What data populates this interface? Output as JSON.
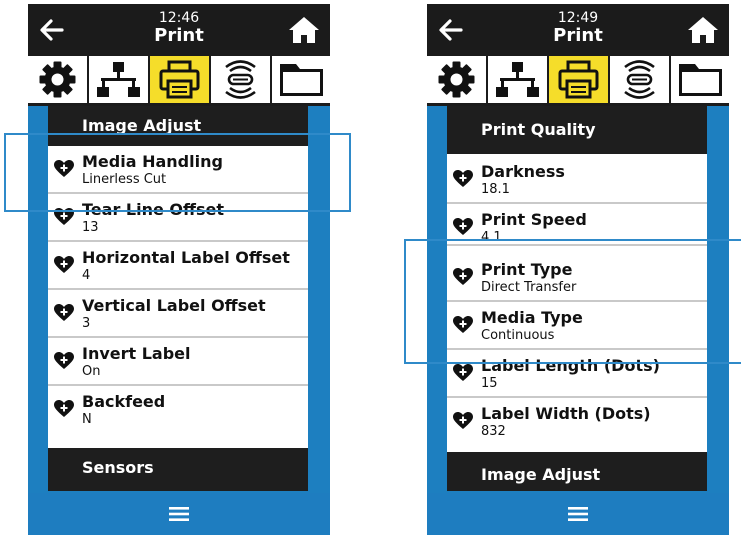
{
  "colors": {
    "accent_blue": "#1d7fc0",
    "selected_tab": "#f5dd2a",
    "bar_dark": "#1b1b1b",
    "callout": "#2f8ac9"
  },
  "icons": [
    "back-arrow-icon",
    "home-icon",
    "settings-gear-icon",
    "network-icon",
    "printer-icon",
    "wireless-icon",
    "folder-icon",
    "heart-plus-icon",
    "hamburger-menu-icon"
  ],
  "left": {
    "time": "12:46",
    "title": "Print",
    "header_top": "Image Adjust",
    "items": [
      {
        "name": "Media Handling",
        "value": "Linerless Cut"
      },
      {
        "name": "Tear Line Offset",
        "value": "13"
      },
      {
        "name": "Horizontal Label Offset",
        "value": "4"
      },
      {
        "name": "Vertical Label Offset",
        "value": "3"
      },
      {
        "name": "Invert Label",
        "value": "On"
      },
      {
        "name": "Backfeed",
        "value": "N"
      }
    ],
    "header_bottom": "Sensors"
  },
  "right": {
    "time": "12:49",
    "title": "Print",
    "header_top": "Print Quality",
    "items": [
      {
        "name": "Darkness",
        "value": "18.1"
      },
      {
        "name": "Print Speed",
        "value": "4.1"
      },
      {
        "name": "Print Type",
        "value": "Direct Transfer"
      },
      {
        "name": "Media Type",
        "value": "Continuous"
      },
      {
        "name": "Label Length (Dots)",
        "value": "15"
      },
      {
        "name": "Label Width (Dots)",
        "value": "832"
      }
    ],
    "header_bottom": "Image Adjust"
  }
}
